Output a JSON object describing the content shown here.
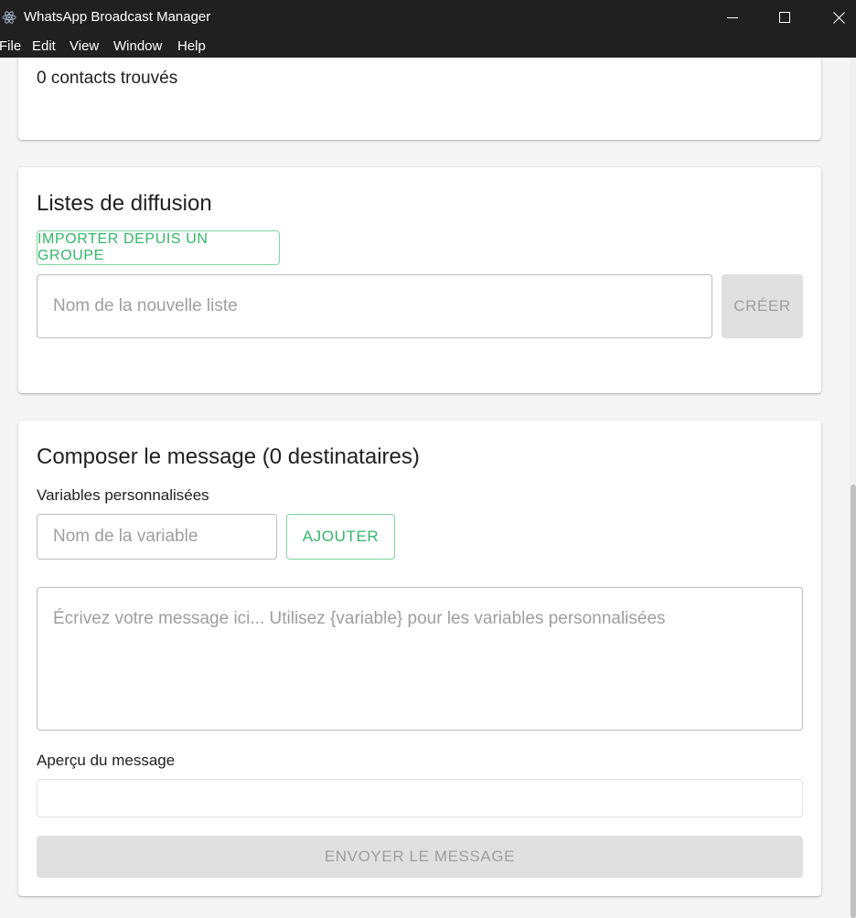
{
  "window": {
    "title": "WhatsApp Broadcast Manager",
    "icon": "electron-icon",
    "controls": [
      "minimize-icon",
      "maximize-icon",
      "close-icon"
    ]
  },
  "menu": [
    "File",
    "Edit",
    "View",
    "Window",
    "Help"
  ],
  "contacts": {
    "count_text": "0 contacts trouvés"
  },
  "broadcast": {
    "heading": "Listes de diffusion",
    "import_button": "IMPORTER DEPUIS UN GROUPE",
    "new_list_placeholder": "Nom de la nouvelle liste",
    "new_list_value": "",
    "create_button": "CRÉER"
  },
  "compose": {
    "heading": "Composer le message (0 destinataires)",
    "variables_label": "Variables personnalisées",
    "variable_placeholder": "Nom de la variable",
    "variable_value": "",
    "add_button": "AJOUTER",
    "message_placeholder": "Écrivez votre message ici... Utilisez {variable} pour les variables personnalisées",
    "message_value": "",
    "preview_label": "Aperçu du message",
    "preview_value": "",
    "send_button": "ENVOYER LE MESSAGE"
  },
  "colors": {
    "accent": "#34b56a",
    "accent_border": "#81d4a0",
    "titlebar": "#202020",
    "disabled_bg": "#e0e0e0",
    "disabled_text": "#9e9e9e"
  }
}
